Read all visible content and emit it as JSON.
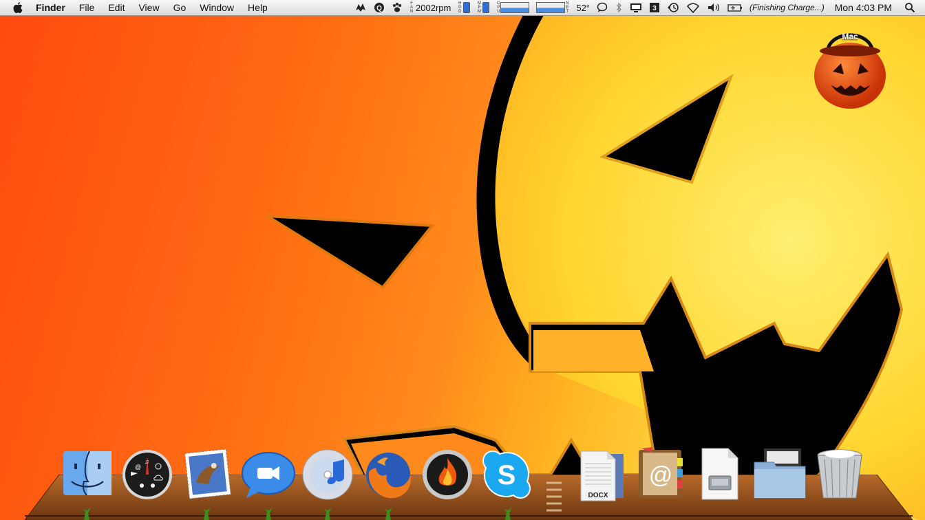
{
  "menubar": {
    "apple_icon": "apple-icon",
    "app_name": "Finder",
    "menus": [
      "File",
      "Edit",
      "View",
      "Go",
      "Window",
      "Help"
    ],
    "status": {
      "fan_label": "FAN",
      "fan_speed": "2002rpm",
      "hdd_label": "HDD",
      "mem_label": "MEM",
      "cpu_label": "CPU",
      "net_label": "NET",
      "temperature": "52°",
      "battery_status": "(Finishing Charge...)",
      "clock": "Mon 4:03 PM"
    }
  },
  "desktop": {
    "icon_label": "Mac"
  },
  "dock": {
    "items": [
      {
        "name": "Finder",
        "icon": "finder-icon"
      },
      {
        "name": "Dashboard",
        "icon": "dashboard-icon"
      },
      {
        "name": "Mail",
        "icon": "mail-icon"
      },
      {
        "name": "iChat",
        "icon": "ichat-icon"
      },
      {
        "name": "iTunes",
        "icon": "itunes-icon"
      },
      {
        "name": "Firefox",
        "icon": "firefox-icon"
      },
      {
        "name": "Burn",
        "icon": "burn-icon"
      },
      {
        "name": "Skype",
        "icon": "skype-icon"
      },
      {
        "name": "Documents",
        "icon": "docx-stack-icon",
        "badge": "DOCX"
      },
      {
        "name": "Address Book",
        "icon": "address-book-icon"
      },
      {
        "name": "Disk Utility",
        "icon": "disk-document-icon"
      },
      {
        "name": "Folder",
        "icon": "folder-icon"
      },
      {
        "name": "Trash",
        "icon": "trash-icon"
      }
    ]
  },
  "colors": {
    "wallpaper_orange": "#ff5a12",
    "wallpaper_yellow": "#ffd23a",
    "running_indicator": "#3c8c1e"
  }
}
